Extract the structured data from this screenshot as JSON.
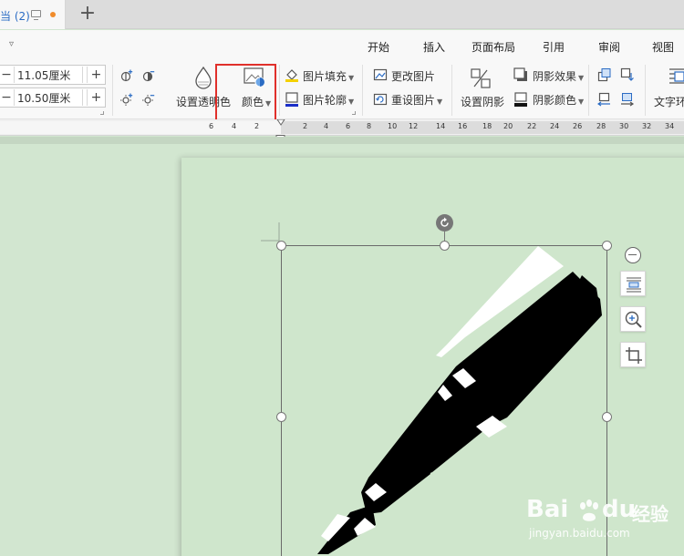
{
  "tab": {
    "title": "当 (2)",
    "unsaved_indicator": "#f08c2c"
  },
  "menu": {
    "collapse": "▿",
    "items": [
      "开始",
      "插入",
      "页面布局",
      "引用",
      "审阅",
      "视图"
    ]
  },
  "size": {
    "height_value": "11.05厘米",
    "width_value": "10.50厘米",
    "minus": "−",
    "plus": "+"
  },
  "buttons": {
    "transparency": "设置透明色",
    "color": "颜色",
    "fill": "图片填充",
    "outline": "图片轮廓",
    "change_picture": "更改图片",
    "reset_picture": "重设图片",
    "set_shadow": "设置阴影",
    "shadow_effect": "阴影效果",
    "shadow_color": "阴影颜色",
    "text_wrap": "文字环"
  },
  "ruler": {
    "left_numbers": [
      "6",
      "4",
      "2"
    ],
    "right_numbers": [
      "2",
      "4",
      "6",
      "8",
      "10",
      "12",
      "14",
      "16",
      "18",
      "20",
      "22",
      "24",
      "26",
      "28",
      "30",
      "32",
      "34"
    ]
  },
  "watermark": {
    "brand": "Bai",
    "brand_end": "du",
    "product": "经验",
    "url": "jingyan.baidu.com"
  },
  "colors": {
    "highlight": "#e0302b",
    "page_background": "#cfe6cc",
    "link_blue": "#2b6cc4"
  },
  "icons": [
    "monitor-icon",
    "plus-icon",
    "brightness-up-icon",
    "contrast-up-icon",
    "brightness-down-icon",
    "contrast-down-icon",
    "transparency-drop-icon",
    "color-picture-icon",
    "fill-bucket-icon",
    "outline-pen-icon",
    "change-picture-icon",
    "reset-picture-icon",
    "shadow-toggle-icon",
    "shadow-effect-icon",
    "shadow-color-icon",
    "rotate-icon",
    "minus-circle-icon",
    "layout-options-icon",
    "zoom-in-icon",
    "crop-icon",
    "paw-icon"
  ]
}
